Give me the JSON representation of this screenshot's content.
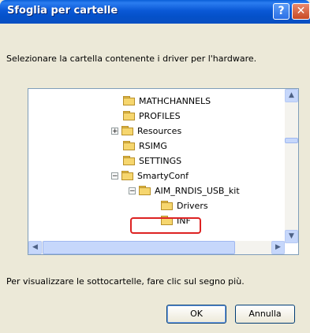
{
  "window": {
    "title": "Sfoglia per cartelle",
    "help_label": "?",
    "close_label": "✕"
  },
  "instruction": "Selezionare la cartella contenente i driver per l'hardware.",
  "tree": {
    "items": [
      {
        "label": "MATHCHANNELS",
        "expander": ""
      },
      {
        "label": "PROFILES",
        "expander": ""
      },
      {
        "label": "Resources",
        "expander": "+"
      },
      {
        "label": "RSIMG",
        "expander": ""
      },
      {
        "label": "SETTINGS",
        "expander": ""
      },
      {
        "label": "SmartyConf",
        "expander": "−"
      },
      {
        "label": "AIM_RNDIS_USB_kit",
        "expander": "−"
      },
      {
        "label": "Drivers",
        "expander": ""
      },
      {
        "label": "INF",
        "expander": "",
        "selected": true
      }
    ]
  },
  "scrollbar": {
    "up": "▲",
    "down": "▼",
    "left": "◀",
    "right": "▶"
  },
  "hint": "Per visualizzare le sottocartelle, fare clic sul segno più.",
  "buttons": {
    "ok": "OK",
    "cancel": "Annulla"
  },
  "colors": {
    "titlebar": "#0a58d6",
    "highlight": "#dd2222"
  }
}
